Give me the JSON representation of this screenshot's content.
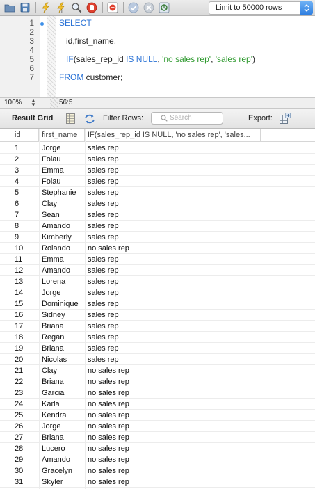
{
  "toolbar": {
    "icons": [
      "folder-open-icon",
      "save-icon",
      "execute-icon",
      "execute-current-icon",
      "explain-icon",
      "stop-icon",
      "toggle-continue-on-error-icon",
      "commit-icon",
      "rollback-icon",
      "autocommit-icon"
    ],
    "limit_label": "Limit to 50000 rows",
    "accent_color": "#2f7fe0"
  },
  "editor": {
    "line_numbers": [
      "1",
      "2",
      "3",
      "4",
      "5",
      "6",
      "7"
    ],
    "lines": [
      [
        {
          "t": "SELECT",
          "c": "kw"
        }
      ],
      [],
      [
        {
          "t": "   id,first_name,",
          "c": ""
        }
      ],
      [],
      [
        {
          "t": "   ",
          "c": ""
        },
        {
          "t": "IF",
          "c": "kw"
        },
        {
          "t": "(sales_rep_id ",
          "c": ""
        },
        {
          "t": "IS NULL",
          "c": "kw"
        },
        {
          "t": ", ",
          "c": ""
        },
        {
          "t": "'no sales rep'",
          "c": "str"
        },
        {
          "t": ", ",
          "c": ""
        },
        {
          "t": "'sales rep'",
          "c": "str"
        },
        {
          "t": ")",
          "c": ""
        }
      ],
      [],
      [
        {
          "t": "FROM",
          "c": "kw"
        },
        {
          "t": " customer;",
          "c": ""
        }
      ]
    ],
    "keyword_color": "#2b73d6",
    "string_color": "#2f9a2f"
  },
  "status": {
    "zoom": "100%",
    "cursor_position": "56:5"
  },
  "result_toolbar": {
    "result_grid_label": "Result Grid",
    "filter_rows_label": "Filter Rows:",
    "search_placeholder": "Search",
    "export_label": "Export:"
  },
  "grid": {
    "columns": [
      "id",
      "first_name",
      "IF(sales_rep_id IS NULL, 'no sales rep', 'sales..."
    ],
    "rows": [
      [
        "1",
        "Jorge",
        "sales rep"
      ],
      [
        "2",
        "Folau",
        "sales rep"
      ],
      [
        "3",
        "Emma",
        "sales rep"
      ],
      [
        "4",
        "Folau",
        "sales rep"
      ],
      [
        "5",
        "Stephanie",
        "sales rep"
      ],
      [
        "6",
        "Clay",
        "sales rep"
      ],
      [
        "7",
        "Sean",
        "sales rep"
      ],
      [
        "8",
        "Amando",
        "sales rep"
      ],
      [
        "9",
        "Kimberly",
        "sales rep"
      ],
      [
        "10",
        "Rolando",
        "no sales rep"
      ],
      [
        "11",
        "Emma",
        "sales rep"
      ],
      [
        "12",
        "Amando",
        "sales rep"
      ],
      [
        "13",
        "Lorena",
        "sales rep"
      ],
      [
        "14",
        "Jorge",
        "sales rep"
      ],
      [
        "15",
        "Dominique",
        "sales rep"
      ],
      [
        "16",
        "Sidney",
        "sales rep"
      ],
      [
        "17",
        "Briana",
        "sales rep"
      ],
      [
        "18",
        "Regan",
        "sales rep"
      ],
      [
        "19",
        "Briana",
        "sales rep"
      ],
      [
        "20",
        "Nicolas",
        "sales rep"
      ],
      [
        "21",
        "Clay",
        "no sales rep"
      ],
      [
        "22",
        "Briana",
        "no sales rep"
      ],
      [
        "23",
        "Garcia",
        "no sales rep"
      ],
      [
        "24",
        "Karla",
        "no sales rep"
      ],
      [
        "25",
        "Kendra",
        "no sales rep"
      ],
      [
        "26",
        "Jorge",
        "no sales rep"
      ],
      [
        "27",
        "Briana",
        "no sales rep"
      ],
      [
        "28",
        "Lucero",
        "no sales rep"
      ],
      [
        "29",
        "Amando",
        "no sales rep"
      ],
      [
        "30",
        "Gracelyn",
        "no sales rep"
      ],
      [
        "31",
        "Skyler",
        "no sales rep"
      ]
    ]
  }
}
